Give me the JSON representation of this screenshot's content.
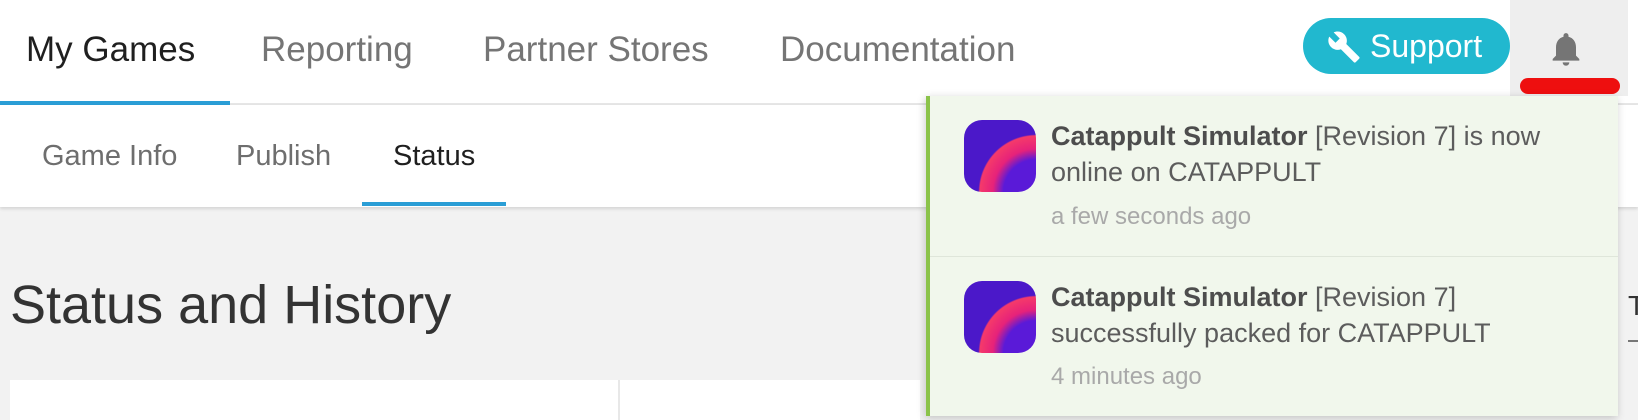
{
  "top_nav": {
    "tabs": [
      {
        "label": "My Games",
        "active": true
      },
      {
        "label": "Reporting",
        "active": false
      },
      {
        "label": "Partner Stores",
        "active": false
      },
      {
        "label": "Documentation",
        "active": false
      }
    ],
    "support_label": "Support",
    "support_icon": "wrench-icon",
    "notifications_icon": "bell-icon"
  },
  "sub_nav": {
    "tabs": [
      {
        "label": "Game Info",
        "active": false
      },
      {
        "label": "Publish",
        "active": false
      },
      {
        "label": "Status",
        "active": true
      }
    ]
  },
  "main": {
    "title": "Status and History",
    "partial_text": "T"
  },
  "notifications": [
    {
      "app_name": "Catappult Simulator",
      "message": " [Revision 7] is now online on CATAPPULT",
      "time": "a few seconds ago"
    },
    {
      "app_name": "Catappult Simulator",
      "message": " [Revision 7] successfully packed for CATAPPULT",
      "time": "4 minutes ago"
    }
  ],
  "colors": {
    "accent_blue": "#2a9ed6",
    "support_button": "#21b8cf",
    "notification_border": "#8bc34a",
    "notification_bg": "#f1f7ec",
    "alert_red": "#ee0f0f"
  }
}
